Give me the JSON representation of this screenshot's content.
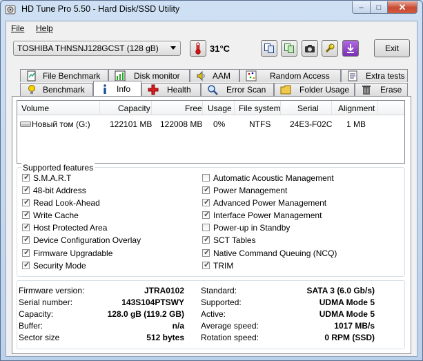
{
  "window": {
    "title": "HD Tune Pro 5.50 - Hard Disk/SSD Utility",
    "minimize": "–",
    "maximize": "□",
    "close": "✕"
  },
  "menu": {
    "file": "File",
    "help": "Help"
  },
  "toolbar": {
    "drive": "TOSHIBA THNSNJ128GCST (128 gB)",
    "temperature": "31°C",
    "exit": "Exit"
  },
  "tabs_back": [
    {
      "label": "File Benchmark",
      "icon": "file-benchmark-icon"
    },
    {
      "label": "Disk monitor",
      "icon": "disk-monitor-icon"
    },
    {
      "label": "AAM",
      "icon": "speaker-icon"
    },
    {
      "label": "Random Access",
      "icon": "random-access-icon"
    },
    {
      "label": "Extra tests",
      "icon": "extra-tests-icon"
    }
  ],
  "tabs_front": [
    {
      "label": "Benchmark",
      "icon": "lightbulb-icon"
    },
    {
      "label": "Info",
      "icon": "info-icon",
      "active": true
    },
    {
      "label": "Health",
      "icon": "health-cross-icon"
    },
    {
      "label": "Error Scan",
      "icon": "magnifier-icon"
    },
    {
      "label": "Folder Usage",
      "icon": "folder-icon"
    },
    {
      "label": "Erase",
      "icon": "trash-icon"
    }
  ],
  "volumes": {
    "headers": [
      "Volume",
      "Capacity",
      "Free",
      "Usage",
      "File system",
      "Serial",
      "Alignment"
    ],
    "rows": [
      [
        "Новый том (G:)",
        "122101 MB",
        "122008 MB",
        "0%",
        "NTFS",
        "24E3-F02C",
        "1 MB"
      ]
    ]
  },
  "features": {
    "legend": "Supported features",
    "left": [
      {
        "label": "S.M.A.R.T",
        "checked": true
      },
      {
        "label": "48-bit Address",
        "checked": true
      },
      {
        "label": "Read Look-Ahead",
        "checked": true
      },
      {
        "label": "Write Cache",
        "checked": true
      },
      {
        "label": "Host Protected Area",
        "checked": true
      },
      {
        "label": "Device Configuration Overlay",
        "checked": true
      },
      {
        "label": "Firmware Upgradable",
        "checked": true
      },
      {
        "label": "Security Mode",
        "checked": true
      }
    ],
    "right": [
      {
        "label": "Automatic Acoustic Management",
        "checked": false
      },
      {
        "label": "Power Management",
        "checked": true
      },
      {
        "label": "Advanced Power Management",
        "checked": true
      },
      {
        "label": "Interface Power Management",
        "checked": true
      },
      {
        "label": "Power-up in Standby",
        "checked": false
      },
      {
        "label": "SCT Tables",
        "checked": true
      },
      {
        "label": "Native Command Queuing (NCQ)",
        "checked": true
      },
      {
        "label": "TRIM",
        "checked": true
      }
    ]
  },
  "details": {
    "left": [
      {
        "key": "Firmware version:",
        "value": "JTRA0102"
      },
      {
        "key": "Serial number:",
        "value": "143S104PTSWY"
      },
      {
        "key": "Capacity:",
        "value": "128.0 gB (119.2 GB)"
      },
      {
        "key": "Buffer:",
        "value": "n/a"
      },
      {
        "key": "Sector size",
        "value": "512 bytes"
      }
    ],
    "right": [
      {
        "key": "Standard:",
        "value": "SATA 3 (6.0 Gb/s)"
      },
      {
        "key": "Supported:",
        "value": "UDMA Mode 5"
      },
      {
        "key": "Active:",
        "value": "UDMA Mode 5"
      },
      {
        "key": "Average speed:",
        "value": "1017 MB/s"
      },
      {
        "key": "Rotation speed:",
        "value": "0 RPM (SSD)"
      }
    ]
  },
  "colors": {
    "accent": "#c0392b",
    "tab_active": "#ffffff",
    "window_frame": "#c9dcf2"
  }
}
